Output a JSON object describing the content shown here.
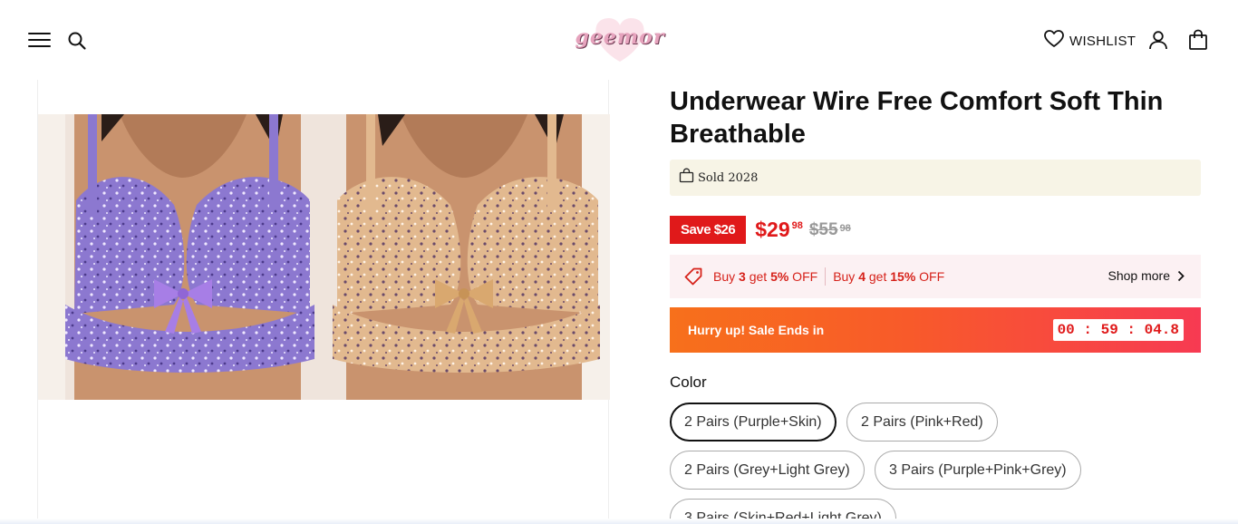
{
  "header": {
    "logo_text": "geemor",
    "wishlist_label": "WISHLIST",
    "icons": [
      "menu-icon",
      "search-icon",
      "heart-icon",
      "account-icon",
      "cart-icon"
    ]
  },
  "gallery": {
    "image_subject": "two bras, purple and skin colored with floral print"
  },
  "product": {
    "title": "Underwear Wire Free Comfort Soft Thin Breathable",
    "sold_text": "Sold 2028",
    "save_badge": "Save $26",
    "price_main": "$29",
    "price_cents": "98",
    "compare_main": "$55",
    "compare_cents": "98",
    "promo": {
      "offer1": {
        "buy": "Buy ",
        "qty": "3",
        "get": " get ",
        "pct": "5%",
        "off": " OFF"
      },
      "offer2": {
        "buy": "Buy ",
        "qty": "4",
        "get": " get ",
        "pct": "15%",
        "off": " OFF"
      },
      "shop_more": "Shop more"
    },
    "sale_label": "Hurry up! Sale Ends in",
    "countdown": "00 : 59 : 04.8",
    "color_label": "Color",
    "color_options": [
      "2 Pairs (Purple+Skin)",
      "2 Pairs (Pink+Red)",
      "2 Pairs (Grey+Light Grey)",
      "3 Pairs (Purple+Pink+Grey)",
      "3 Pairs (Skin+Red+Light Grey)"
    ],
    "selected_color": "2 Pairs (Purple+Skin)"
  },
  "colors": {
    "accent_red": "#e0191a",
    "sold_bg": "#f7f4e6",
    "promo_bg": "#fcf1f3",
    "sale_gradient_start": "#f7701b",
    "sale_gradient_end": "#f73a52"
  }
}
